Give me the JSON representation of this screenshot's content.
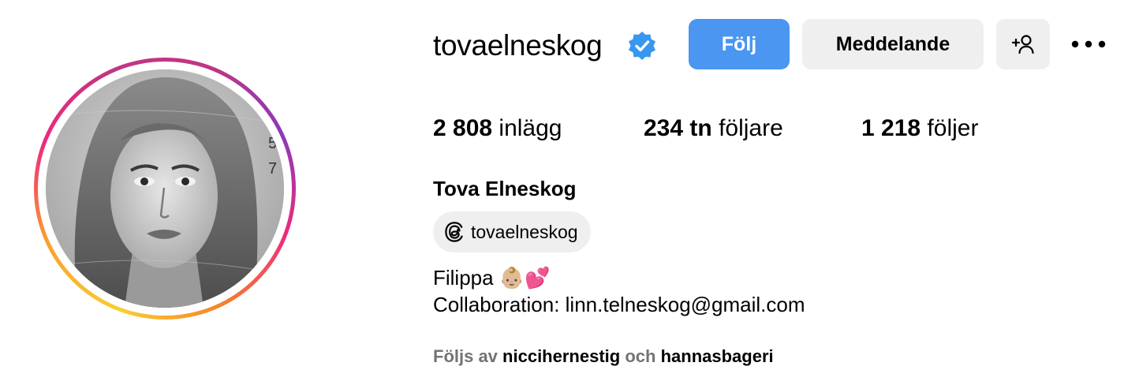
{
  "profile": {
    "username": "tovaelneskog",
    "full_name": "Tova Elneskog",
    "verified": true
  },
  "actions": {
    "follow_label": "Följ",
    "message_label": "Meddelande",
    "add_icon": "person-add-icon",
    "more_icon": "more-options-icon"
  },
  "stats": {
    "posts_count": "2 808",
    "posts_label": "inlägg",
    "followers_count": "234 tn",
    "followers_label": "följare",
    "following_count": "1 218",
    "following_label": "följer"
  },
  "threads": {
    "handle": "tovaelneskog",
    "icon": "threads-icon"
  },
  "bio": {
    "line1": "Filippa 👶🏼💕",
    "line2": "Collaboration: linn.telneskog@gmail.com"
  },
  "followed_by": {
    "prefix": "Följs av",
    "user1": "niccihernestig",
    "joiner": "och",
    "user2": "hannasbageri"
  },
  "colors": {
    "follow_button": "#4a96f0",
    "secondary_button": "#efefef",
    "verified_badge": "#3897f0",
    "muted_text": "#737373"
  }
}
